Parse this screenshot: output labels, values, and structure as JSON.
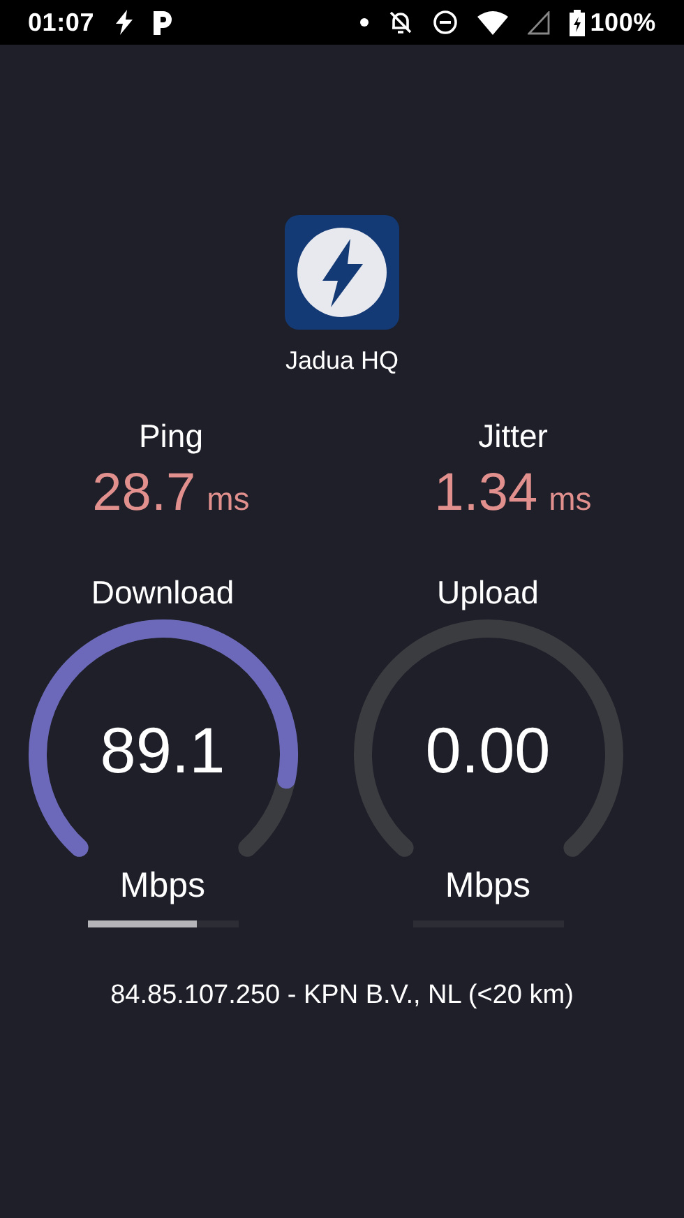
{
  "status_bar": {
    "time": "01:07",
    "battery": "100%"
  },
  "server": {
    "name": "Jadua HQ"
  },
  "stats": [
    {
      "label": "Ping",
      "value": "28.7",
      "unit": "ms"
    },
    {
      "label": "Jitter",
      "value": "1.34",
      "unit": "ms"
    }
  ],
  "gauges": [
    {
      "label": "Download",
      "value": "89.1",
      "unit": "Mbps",
      "progress": {
        "level": 0.73
      }
    },
    {
      "label": "Upload",
      "value": "0.00",
      "unit": "Mbps"
    }
  ],
  "connection": "84.85.107.250 - KPN B.V., NL (<20 km)"
}
